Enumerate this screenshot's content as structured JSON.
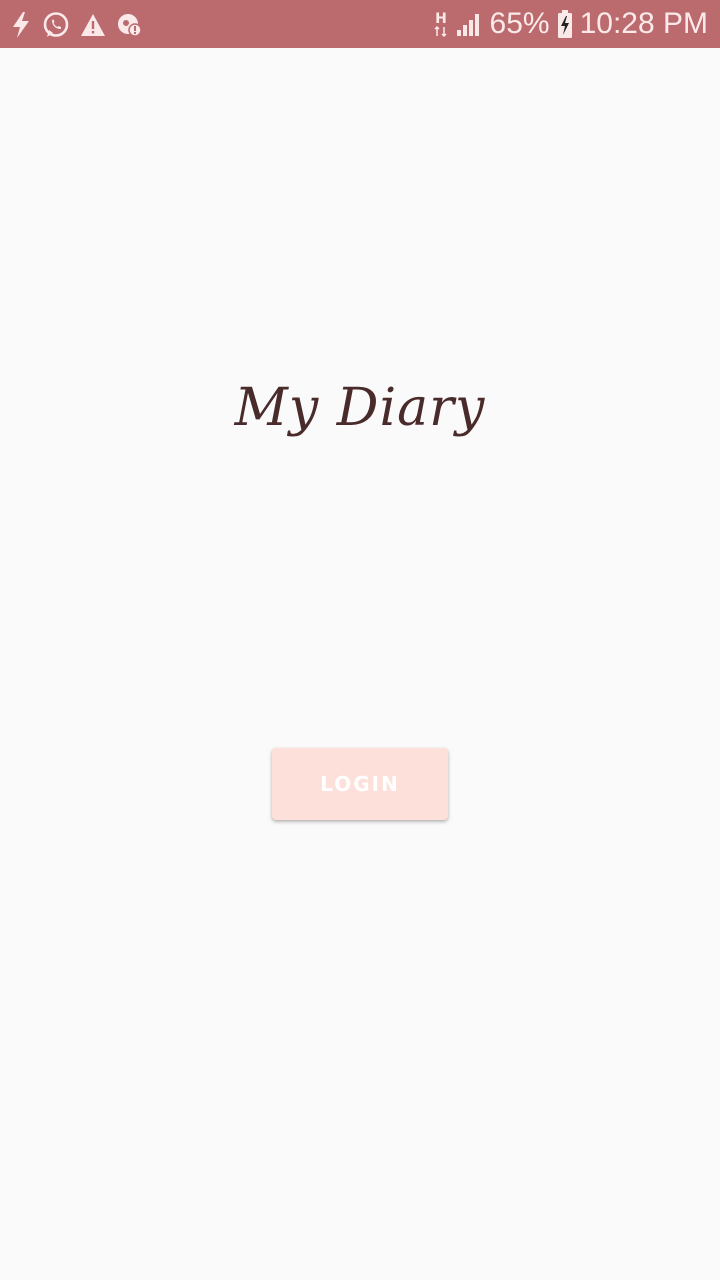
{
  "status_bar": {
    "color": "#bb6b6e",
    "left_icons": [
      "flash-icon",
      "whatsapp-icon",
      "warning-icon",
      "location-alert-icon"
    ],
    "network_type": "H",
    "battery_percent": "65%",
    "time": "10:28 PM"
  },
  "main": {
    "title": "My Diary",
    "title_color": "#4a2b2b",
    "login_button": {
      "label": "LOGIN",
      "color": "#fde0da"
    }
  }
}
